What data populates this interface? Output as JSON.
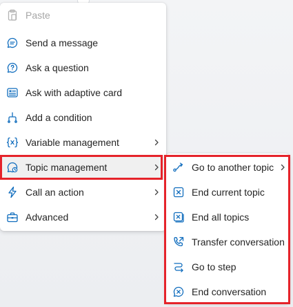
{
  "main_menu": {
    "items": [
      {
        "label": "Paste",
        "icon": "clipboard-icon",
        "disabled": true
      },
      {
        "label": "Send a message",
        "icon": "chat-bubble-icon"
      },
      {
        "label": "Ask a question",
        "icon": "question-bubble-icon"
      },
      {
        "label": "Ask with adaptive card",
        "icon": "adaptive-card-icon"
      },
      {
        "label": "Add a condition",
        "icon": "branch-icon"
      },
      {
        "label": "Variable management",
        "icon": "variable-braces-icon",
        "has_submenu": true
      },
      {
        "label": "Topic management",
        "icon": "topic-bubble-icon",
        "has_submenu": true,
        "selected": true
      },
      {
        "label": "Call an action",
        "icon": "lightning-icon",
        "has_submenu": true
      },
      {
        "label": "Advanced",
        "icon": "toolbox-icon",
        "has_submenu": true
      }
    ]
  },
  "sub_menu": {
    "items": [
      {
        "label": "Go to another topic",
        "icon": "redirect-arrow-icon",
        "has_submenu": true
      },
      {
        "label": "End current topic",
        "icon": "end-current-topic-icon"
      },
      {
        "label": "End all topics",
        "icon": "end-all-topics-icon"
      },
      {
        "label": "Transfer conversation",
        "icon": "phone-transfer-icon"
      },
      {
        "label": "Go to step",
        "icon": "go-to-step-icon"
      },
      {
        "label": "End conversation",
        "icon": "end-conversation-icon"
      }
    ]
  },
  "colors": {
    "highlight": "#e5232a",
    "icon_accent": "#0f6cbd",
    "text": "#242424",
    "disabled_text": "#a6a6a6"
  }
}
